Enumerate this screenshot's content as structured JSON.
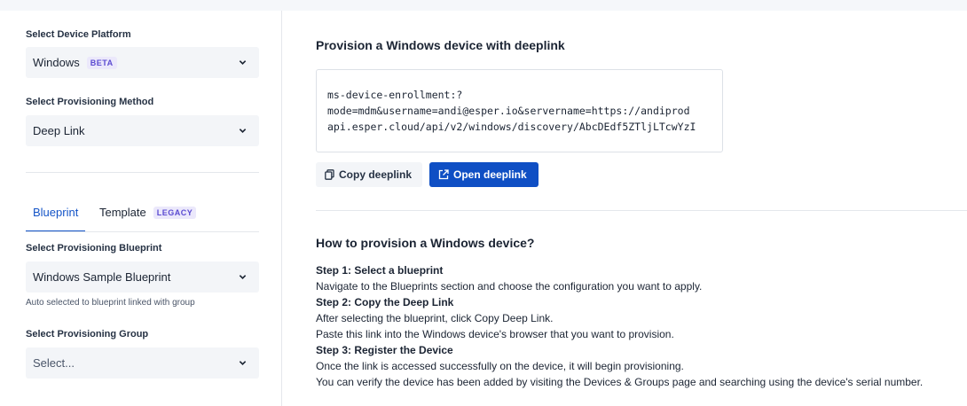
{
  "sidebar": {
    "platform_label": "Select Device Platform",
    "platform_value": "Windows",
    "platform_badge": "BETA",
    "method_label": "Select Provisioning Method",
    "method_value": "Deep Link",
    "tabs": [
      {
        "label": "Blueprint",
        "active": true
      },
      {
        "label": "Template",
        "badge": "LEGACY",
        "active": false
      }
    ],
    "blueprint_label": "Select Provisioning Blueprint",
    "blueprint_value": "Windows Sample Blueprint",
    "blueprint_hint": "Auto selected to blueprint linked with group",
    "group_label": "Select Provisioning Group",
    "group_placeholder": "Select..."
  },
  "main": {
    "title": "Provision a Windows device with deeplink",
    "deeplink_lines": [
      "ms-device-enrollment:?",
      "mode=mdm&username=andi@esper.io&servername=https://andiprod",
      "api.esper.cloud/api/v2/windows/discovery/AbcDEdf5ZTljLTcwYzI"
    ],
    "copy_label": "Copy deeplink",
    "open_label": "Open deeplink",
    "howto_title": "How to provision a Windows device?",
    "steps": [
      {
        "title": "Step 1: Select a blueprint",
        "lines": [
          "Navigate to the Blueprints section and choose the configuration you want to apply."
        ]
      },
      {
        "title": "Step 2: Copy the Deep Link",
        "lines": [
          "After selecting the blueprint, click Copy Deep Link.",
          "Paste this link into the Windows device's browser that you want to provision."
        ]
      },
      {
        "title": "Step 3: Register the Device",
        "lines": [
          "Once the link is accessed successfully on the device, it will begin provisioning.",
          "You can verify the device has been added by visiting the Devices & Groups page and searching using the device's serial number."
        ]
      }
    ]
  },
  "icons": {
    "chevron": "chevron-down-icon",
    "copy": "copy-icon",
    "external": "external-link-icon"
  },
  "colors": {
    "accent": "#0f4fc4",
    "badge_bg": "#ebe8fb",
    "badge_text": "#5b4bd1"
  }
}
